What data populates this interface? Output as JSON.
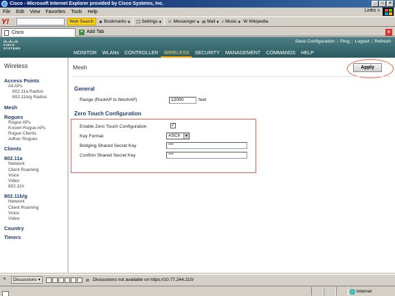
{
  "window": {
    "title": "Cisco - Microsoft Internet Explorer provided by Cisco Systems, Inc."
  },
  "menu": [
    "File",
    "Edit",
    "View",
    "Favorites",
    "Tools",
    "Help"
  ],
  "menu_links": "Links",
  "toolbar": {
    "search_button": "Web Search",
    "bookmarks": "Bookmarks",
    "settings": "Settings",
    "messenger": "Messenger",
    "mail": "Mail",
    "music": "Music",
    "wikipedia": "Wikipedia"
  },
  "tabs": {
    "active": "Cisco",
    "add": "Add Tab"
  },
  "cisco": {
    "logo_word": "CISCO SYSTEMS",
    "utility": [
      "Save Configuration",
      "Ping",
      "Logout",
      "Refresh"
    ],
    "nav": [
      "MONITOR",
      "WLANs",
      "CONTROLLER",
      "WIRELESS",
      "SECURITY",
      "MANAGEMENT",
      "COMMANDS",
      "HELP"
    ],
    "active_nav": "WIRELESS"
  },
  "sidebar": {
    "title": "Wireless",
    "groups": [
      {
        "head": "Access Points",
        "items": [
          {
            "label": "All APs",
            "level": 1
          },
          {
            "label": "802.11a Radios",
            "level": 2
          },
          {
            "label": "802.11b/g Radios",
            "level": 2
          }
        ]
      },
      {
        "head": "Mesh",
        "items": []
      },
      {
        "head": "Rogues",
        "items": [
          {
            "label": "Rogue APs",
            "level": 1
          },
          {
            "label": "Known Rogue APs",
            "level": 1
          },
          {
            "label": "Rogue Clients",
            "level": 1
          },
          {
            "label": "Adhoc Rogues",
            "level": 1
          }
        ]
      },
      {
        "head": "Clients",
        "items": []
      },
      {
        "head": "802.11a",
        "items": [
          {
            "label": "Network",
            "level": 1
          },
          {
            "label": "Client Roaming",
            "level": 1
          },
          {
            "label": "Voice",
            "level": 1
          },
          {
            "label": "Video",
            "level": 1
          },
          {
            "label": "802.11h",
            "level": 1
          }
        ]
      },
      {
        "head": "802.11b/g",
        "items": [
          {
            "label": "Network",
            "level": 1
          },
          {
            "label": "Client Roaming",
            "level": 1
          },
          {
            "label": "Voice",
            "level": 1
          },
          {
            "label": "Video",
            "level": 1
          }
        ]
      },
      {
        "head": "Country",
        "items": []
      },
      {
        "head": "Timers",
        "items": []
      }
    ]
  },
  "page": {
    "title": "Mesh",
    "apply": "Apply",
    "general": {
      "heading": "General",
      "range_label": "Range (RootAP to MeshAP)",
      "range_value": "12000",
      "range_unit": "feet"
    },
    "ztc": {
      "heading": "Zero Touch Configuration",
      "enable_label": "Enable Zero Touch Configuration",
      "enable_checked": "✓",
      "key_format_label": "Key Format",
      "key_format_value": "ASCII",
      "bridging_label": "Bridging Shared Secret Key",
      "bridging_value": "***",
      "confirm_label": "Confirm Shared Secret Key",
      "confirm_value": "***"
    }
  },
  "statusbar": {
    "discussions": "Discussions",
    "message": "Discussions not available on https://10.77.244.210/",
    "zone": "Internet"
  }
}
